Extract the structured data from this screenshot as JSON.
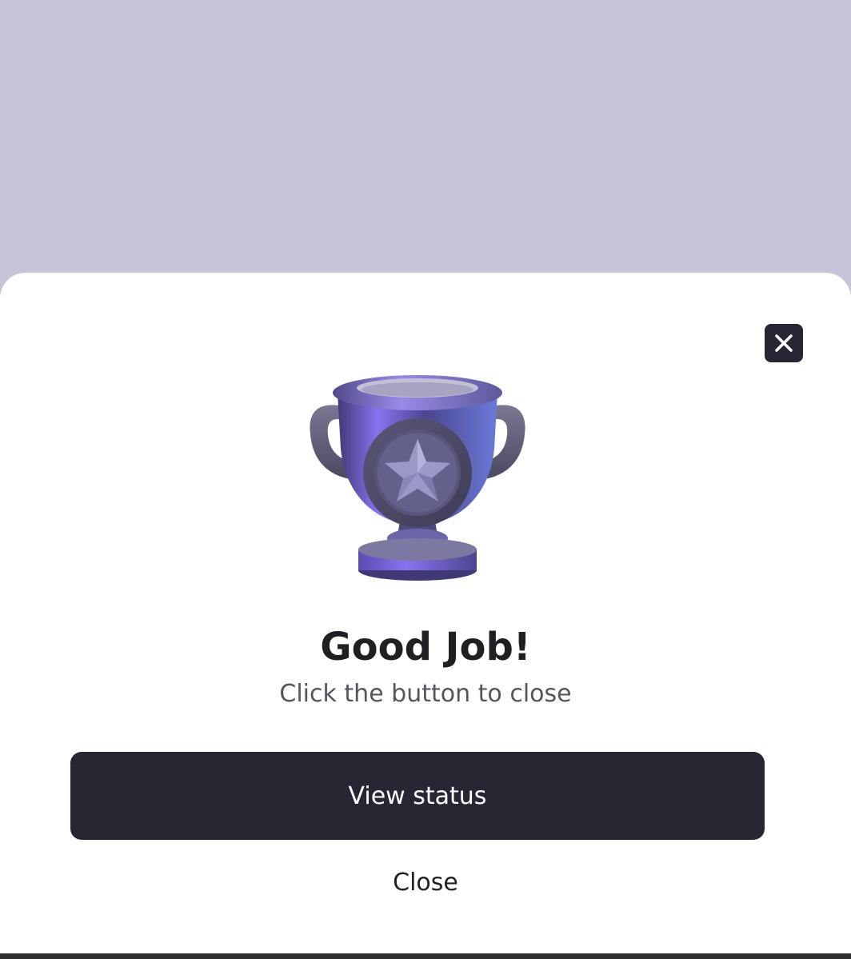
{
  "modal": {
    "title": "Good Job!",
    "subtitle": "Click the button to close",
    "primary_button_label": "View status",
    "secondary_button_label": "Close",
    "close_icon": "close-icon",
    "illustration_icon": "trophy-icon"
  },
  "colors": {
    "backdrop": "#c5c4d8",
    "sheet": "#ffffff",
    "primary": "#272733",
    "accent": "#6f5fd6"
  }
}
